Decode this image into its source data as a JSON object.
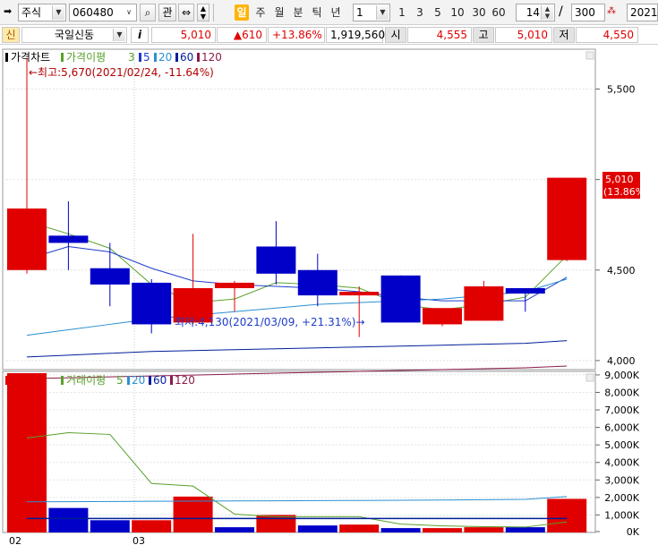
{
  "toolbar": {
    "market": "주식",
    "code": "060480",
    "favorite_label": "관",
    "periods": [
      "일",
      "주",
      "월",
      "분",
      "틱",
      "년"
    ],
    "active_period": "일",
    "interval_value": "1",
    "interval_buttons": [
      "1",
      "3",
      "5",
      "10",
      "30",
      "60"
    ],
    "view_count": "14",
    "total_count": "300",
    "date": "2021/"
  },
  "info": {
    "badge": "신",
    "stock_name": "국일신동",
    "info_button": "i",
    "price": "5,010",
    "change": "▲610",
    "change_rate": "+13.86%",
    "volume": "1,919,560",
    "open_label": "시",
    "open": "4,555",
    "high_label": "고",
    "high": "5,010",
    "low_label": "저",
    "low": "4,550"
  },
  "price_panel": {
    "title": "가격차트",
    "ma_title": "가격이평",
    "ma_periods": [
      "3",
      "5",
      "20",
      "60",
      "120"
    ],
    "max_annotation": "←최고:5,670(2021/02/24, -11.64%)",
    "min_annotation": "최저:4,130(2021/03/09, +21.31%)→",
    "last_price_label": "5,010",
    "last_rate_label": "(13.86%)"
  },
  "volume_panel": {
    "title": "거래량",
    "ma_title": "거래이평",
    "ma_periods": [
      "5",
      "20",
      "60",
      "120"
    ]
  },
  "x_labels": [
    "02",
    "03"
  ],
  "colors": {
    "up": "#e00000",
    "down": "#0000c8",
    "ma3": "#5aa02c",
    "ma5": "#1e3ccc",
    "ma20": "#2b8fd1",
    "ma60": "#001e9a",
    "ma120": "#8b1a4a",
    "vol_ma5": "#5aa02c",
    "vol_ma20": "#2b8fd1",
    "vol_ma60": "#001e9a",
    "vol_ma120": "#8b1a4a"
  },
  "chart_data": [
    {
      "type": "candlestick",
      "title": "가격차트",
      "ylim": [
        3950,
        5720
      ],
      "yticks": [
        4000,
        4500,
        5000,
        5500
      ],
      "ytick_labels": [
        "4,000",
        "4,500",
        "5,000",
        "5,500"
      ],
      "x_labels": [
        "02",
        "03"
      ],
      "candles": [
        {
          "o": 4500,
          "h": 5670,
          "l": 4480,
          "c": 4840
        },
        {
          "o": 4690,
          "h": 4880,
          "l": 4500,
          "c": 4650
        },
        {
          "o": 4510,
          "h": 4650,
          "l": 4300,
          "c": 4420
        },
        {
          "o": 4430,
          "h": 4450,
          "l": 4150,
          "c": 4200
        },
        {
          "o": 4210,
          "h": 4700,
          "l": 4200,
          "c": 4400
        },
        {
          "o": 4400,
          "h": 4440,
          "l": 4270,
          "c": 4430
        },
        {
          "o": 4630,
          "h": 4770,
          "l": 4420,
          "c": 4480
        },
        {
          "o": 4500,
          "h": 4590,
          "l": 4300,
          "c": 4360
        },
        {
          "o": 4360,
          "h": 4410,
          "l": 4130,
          "c": 4380
        },
        {
          "o": 4470,
          "h": 4470,
          "l": 4210,
          "c": 4210
        },
        {
          "o": 4200,
          "h": 4280,
          "l": 4190,
          "c": 4290
        },
        {
          "o": 4220,
          "h": 4440,
          "l": 4220,
          "c": 4410
        },
        {
          "o": 4400,
          "h": 4400,
          "l": 4270,
          "c": 4370
        },
        {
          "o": 4555,
          "h": 5010,
          "l": 4550,
          "c": 5010
        }
      ],
      "series": [
        {
          "name": "3",
          "values": [
            4770,
            4700,
            4620,
            4420,
            4320,
            4340,
            4430,
            4420,
            4400,
            4310,
            4280,
            4310,
            4350,
            4580
          ]
        },
        {
          "name": "5",
          "values": [
            4560,
            4630,
            4600,
            4510,
            4440,
            4420,
            4410,
            4400,
            4380,
            4350,
            4330,
            4330,
            4330,
            4460
          ]
        },
        {
          "name": "20",
          "values": [
            4140,
            4170,
            4200,
            4230,
            4250,
            4270,
            4290,
            4310,
            4320,
            4330,
            4340,
            4360,
            4380,
            4450
          ]
        },
        {
          "name": "60",
          "values": [
            4020,
            4030,
            4040,
            4050,
            4055,
            4060,
            4065,
            4070,
            4075,
            4080,
            4085,
            4090,
            4095,
            4110
          ]
        },
        {
          "name": "120",
          "values": [
            3900,
            3905,
            3910,
            3915,
            3920,
            3925,
            3930,
            3935,
            3940,
            3945,
            3950,
            3955,
            3960,
            3970
          ]
        }
      ]
    },
    {
      "type": "bar",
      "title": "거래량",
      "ylim": [
        0,
        9200000
      ],
      "yticks": [
        0,
        1000000,
        2000000,
        3000000,
        4000000,
        5000000,
        6000000,
        7000000,
        8000000,
        9000000
      ],
      "ytick_labels": [
        "0K",
        "1,000K",
        "2,000K",
        "3,000K",
        "4,000K",
        "5,000K",
        "6,000K",
        "7,000K",
        "8,000K",
        "9,000K"
      ],
      "values": [
        9300000,
        1400000,
        700000,
        700000,
        2050000,
        300000,
        1000000,
        400000,
        450000,
        250000,
        250000,
        300000,
        300000,
        1919560
      ],
      "up": [
        true,
        false,
        false,
        true,
        true,
        false,
        true,
        false,
        true,
        false,
        true,
        true,
        false,
        true
      ],
      "series": [
        {
          "name": "5",
          "values": [
            5400000,
            5700000,
            5600000,
            2800000,
            2650000,
            1050000,
            900000,
            900000,
            900000,
            480000,
            380000,
            330000,
            310000,
            600000
          ]
        },
        {
          "name": "20",
          "values": [
            1750000,
            1760000,
            1770000,
            1780000,
            1790000,
            1800000,
            1810000,
            1820000,
            1830000,
            1840000,
            1850000,
            1870000,
            1890000,
            2050000
          ]
        },
        {
          "name": "60",
          "values": [
            800000,
            800000,
            800000,
            800000,
            800000,
            800000,
            800000,
            800000,
            800000,
            800000,
            800000,
            800000,
            800000,
            800000
          ]
        }
      ]
    }
  ]
}
